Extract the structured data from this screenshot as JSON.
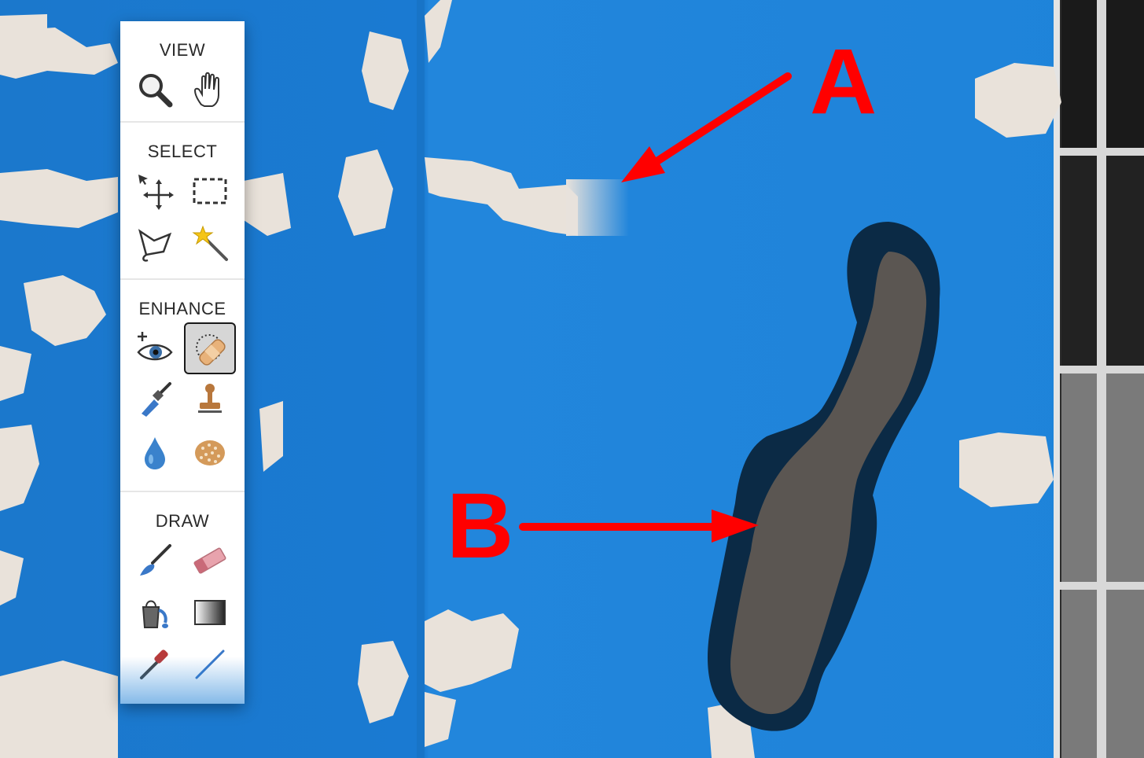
{
  "toolbar": {
    "sections": [
      {
        "title": "VIEW",
        "tools": [
          "zoom-tool",
          "hand-tool"
        ]
      },
      {
        "title": "SELECT",
        "tools": [
          "move-tool",
          "marquee-tool",
          "lasso-tool",
          "magic-wand-tool"
        ]
      },
      {
        "title": "ENHANCE",
        "tools": [
          "red-eye-tool",
          "healing-brush-tool",
          "smudge-tool",
          "clone-stamp-tool",
          "blur-drop-tool",
          "sponge-tool"
        ]
      },
      {
        "title": "DRAW",
        "tools": [
          "brush-tool",
          "eraser-tool",
          "paint-bucket-tool",
          "gradient-tool",
          "eyedropper-tool",
          "line-tool"
        ]
      }
    ],
    "active_tool": "healing-brush-tool"
  },
  "annotations": {
    "label_a": "A",
    "label_b": "B",
    "color": "#ff0000"
  },
  "colors": {
    "wall_blue": "#1f80d6",
    "paint_white": "#e9e2da",
    "stroke_dark": "#0b2a45",
    "stroke_fill": "#5b5652",
    "active_tool_bg": "#d6d6d6"
  }
}
